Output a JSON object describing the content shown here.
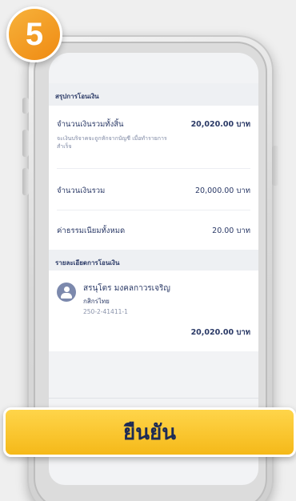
{
  "step_badge": "5",
  "summary": {
    "header": "สรุปการโอนเงิน",
    "total_label": "จำนวนเงินรวมทั้งสิ้น",
    "total_value": "20,020.00 บาท",
    "note": "จะเงินบริจาคจะถูกหักจากบัญชี เมื่อทำรายการสำเร็จ",
    "sum_label": "จำนวนเงินรวม",
    "sum_value": "20,000.00 บาท",
    "fee_label": "ค่าธรรมเนียมทั้งหมด",
    "fee_value": "20.00 บาท"
  },
  "details": {
    "header": "รายละเอียดการโอนเงิน",
    "recipient_name": "สรนุโตร มงคลกาวรเจริญ",
    "bank": "กสิกรไทย",
    "account": "250-2-41411-1",
    "amount": "20,020.00 บาท"
  },
  "confirm_label": "ยืนยัน"
}
